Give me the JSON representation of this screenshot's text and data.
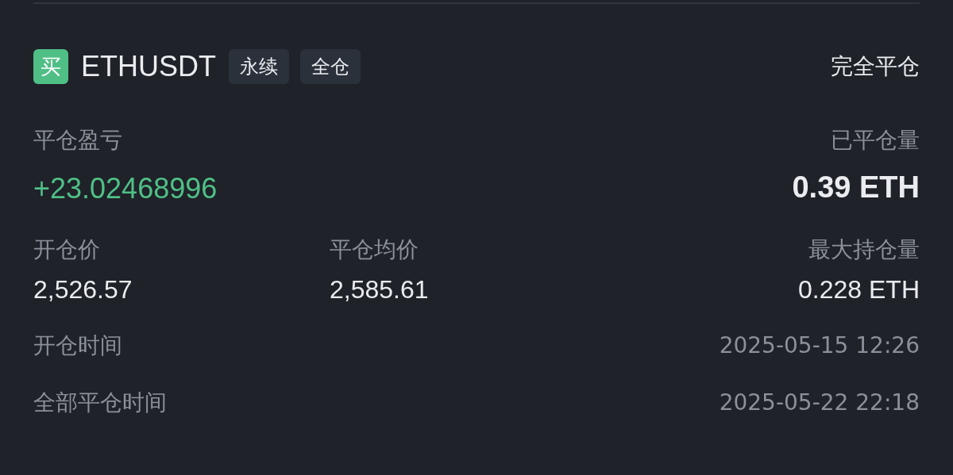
{
  "header": {
    "side_badge": "买",
    "symbol": "ETHUSDT",
    "tags": [
      "永续",
      "全仓"
    ],
    "action": "完全平仓"
  },
  "pnl": {
    "label": "平仓盈亏",
    "value": "+23.02468996"
  },
  "closed_qty": {
    "label": "已平仓量",
    "value": "0.39 ETH"
  },
  "prices": [
    {
      "label": "开仓价",
      "value": "2,526.57"
    },
    {
      "label": "平仓均价",
      "value": "2,585.61"
    },
    {
      "label": "最大持仓量",
      "value": "0.228 ETH"
    }
  ],
  "times": [
    {
      "label": "开仓时间",
      "value": "2025-05-15 12:26"
    },
    {
      "label": "全部平仓时间",
      "value": "2025-05-22 22:18"
    }
  ]
}
